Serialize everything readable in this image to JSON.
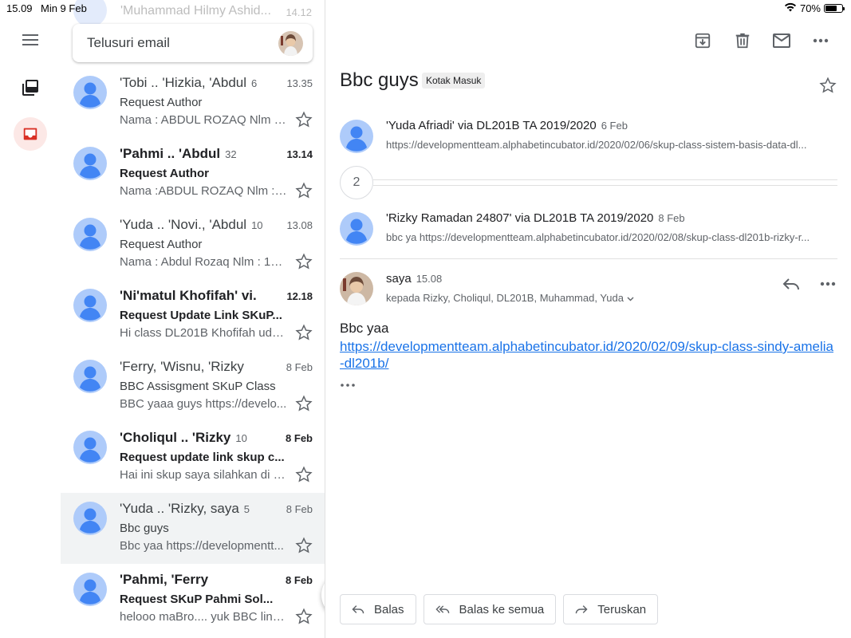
{
  "status_bar": {
    "time": "15.09",
    "date": "Min 9 Feb",
    "battery": "70%"
  },
  "search": {
    "placeholder": "Telusuri email"
  },
  "peek_row": {
    "sender": "'Muhammad Hilmy Ashid...",
    "time": "14.12"
  },
  "threads": [
    {
      "sender": "'Tobi .. 'Hizkia, 'Abdul",
      "count": "6",
      "time": "13.35",
      "subject": "Request Author",
      "snippet": "Nama : ABDUL ROZAQ Nlm :...",
      "unread": false,
      "selected": false
    },
    {
      "sender": "'Pahmi .. 'Abdul",
      "count": "32",
      "time": "13.14",
      "subject": "Request Author",
      "snippet": "Nama :ABDUL ROZAQ Nlm :1...",
      "unread": true,
      "selected": false
    },
    {
      "sender": "'Yuda .. 'Novi., 'Abdul",
      "count": "10",
      "time": "13.08",
      "subject": "Request Author",
      "snippet": "Nama : Abdul Rozaq Nlm : 18...",
      "unread": false,
      "selected": false
    },
    {
      "sender": "'Ni'matul Khofifah' vi.",
      "count": "",
      "time": "12.18",
      "subject": "Request Update Link SKuP...",
      "snippet": "Hi class DL201B Khofifah uda...",
      "unread": true,
      "selected": false
    },
    {
      "sender": "'Ferry, 'Wisnu, 'Rizky",
      "count": "",
      "time": "8 Feb",
      "subject": "BBC Assisgment SKuP Class",
      "snippet": "BBC yaaa guys https://develo...",
      "unread": false,
      "selected": false
    },
    {
      "sender": "'Choliqul .. 'Rizky",
      "count": "10",
      "time": "8 Feb",
      "subject": "Request update link skup c...",
      "snippet": "Hai ini skup saya silahkan di c...",
      "unread": true,
      "selected": false
    },
    {
      "sender": "'Yuda .. 'Rizky, saya",
      "count": "5",
      "time": "8 Feb",
      "subject": "Bbc guys",
      "snippet": "Bbc yaa https://developmentt...",
      "unread": false,
      "selected": true
    },
    {
      "sender": "'Pahmi, 'Ferry",
      "count": "",
      "time": "8 Feb",
      "subject": "Request SKuP Pahmi Sol...",
      "snippet": "helooo maBro.... yuk BBC link...",
      "unread": true,
      "selected": false
    }
  ],
  "reading": {
    "title": "Bbc guys",
    "label": "Kotak Masuk",
    "messages": [
      {
        "sender": "'Yuda Afriadi' via DL201B TA 2019/2020",
        "date": "6 Feb",
        "snippet": "https://developmentteam.alphabetincubator.id/2020/02/06/skup-class-sistem-basis-data-dl..."
      },
      {
        "sender": "'Rizky Ramadan 24807' via DL201B TA 2019/2020",
        "date": "8 Feb",
        "snippet": "bbc ya https://developmentteam.alphabetincubator.id/2020/02/08/skup-class-dl201b-rizky-r..."
      }
    ],
    "collapsed_count": "2",
    "open_message": {
      "sender": "saya",
      "time": "15.08",
      "to": "kepada Rizky, Choliqul, DL201B, Muhammad, Yuda",
      "body": "Bbc yaa",
      "link": "https://developmentteam.alphabetincubator.id/2020/02/09/skup-class-sindy-amelia-dl201b/"
    },
    "actions": {
      "reply": "Balas",
      "reply_all": "Balas ke semua",
      "forward": "Teruskan"
    }
  },
  "colors": {
    "avatar_bg": "#aecbfa",
    "avatar_fg": "#4285f4",
    "link": "#1a73e8",
    "inbox_active": "#d93025",
    "selected_row": "#f1f3f4"
  }
}
